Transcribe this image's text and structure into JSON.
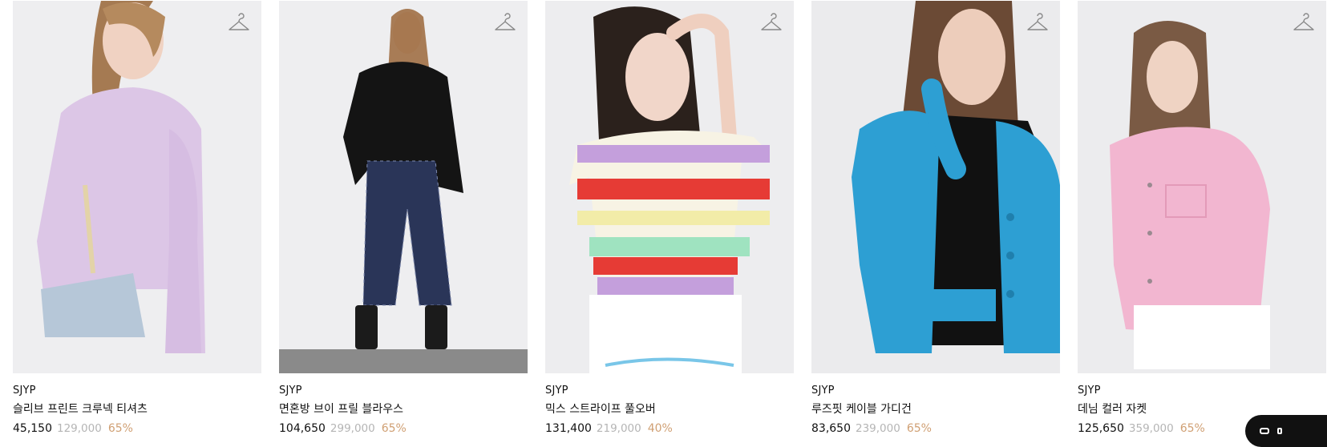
{
  "products": [
    {
      "brand": "SJYP",
      "name": "슬리브 프린트 크루넥 티셔츠",
      "price": "45,150",
      "original_price": "129,000",
      "discount": "65%"
    },
    {
      "brand": "SJYP",
      "name": "면혼방 브이 프릴 블라우스",
      "price": "104,650",
      "original_price": "299,000",
      "discount": "65%"
    },
    {
      "brand": "SJYP",
      "name": "믹스 스트라이프 풀오버",
      "price": "131,400",
      "original_price": "219,000",
      "discount": "40%"
    },
    {
      "brand": "SJYP",
      "name": "루즈핏 케이블 가디건",
      "price": "83,650",
      "original_price": "239,000",
      "discount": "65%"
    },
    {
      "brand": "SJYP",
      "name": "데님 컬러 자켓",
      "price": "125,650",
      "original_price": "359,000",
      "discount": "65%"
    }
  ],
  "icons": {
    "wishlist": "hanger-icon",
    "chat": "chat-icon"
  },
  "colors": {
    "discount": "#d0a074",
    "original_price": "#b5b5b5",
    "text": "#111111"
  }
}
